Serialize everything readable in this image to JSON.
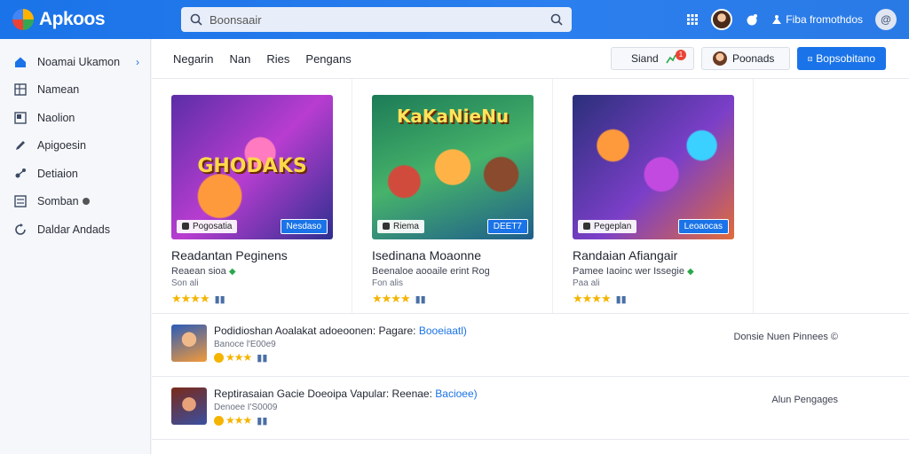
{
  "app": {
    "name": "Apkoos"
  },
  "search": {
    "placeholder": "Boonsaair"
  },
  "topbar": {
    "user_label": "Fiba fromothdos",
    "avatar_letter": "@"
  },
  "sidebar": {
    "items": [
      {
        "label": "Noamai Ukamon",
        "icon": "home-icon"
      },
      {
        "label": "Namean",
        "icon": "grid-icon"
      },
      {
        "label": "Naolion",
        "icon": "window-icon"
      },
      {
        "label": "Apigoesin",
        "icon": "pen-icon"
      },
      {
        "label": "Detiaion",
        "icon": "share-icon"
      },
      {
        "label": "Somban",
        "icon": "list-icon"
      },
      {
        "label": "Daldar Andads",
        "icon": "refresh-icon"
      }
    ]
  },
  "tabs": [
    "Negarin",
    "Nan",
    "Ries",
    "Pengans"
  ],
  "toolbar": {
    "siand_label": "Siand",
    "poonads_label": "Poonads",
    "primary_label": "Bopsobitano",
    "badge": "1"
  },
  "featured": [
    {
      "art_text": "GHODAKS",
      "chip": "Pogosatia",
      "button": "Nesdaso",
      "title": "Readantan Peginens",
      "sub": "Reaean sioa",
      "sub2": "Son ali",
      "stars": "★★★★"
    },
    {
      "art_text": "KaKaNieNu",
      "chip": "Riema",
      "button": "DEET7",
      "title": "Isedinana Moaonne",
      "sub": "Beenaloe aooaile erint Rog",
      "sub2": "Fon alis",
      "stars": "★★★★"
    },
    {
      "art_text": "",
      "chip": "Pegeplan",
      "button": "Leoaocas",
      "title": "Randaian Afiangair",
      "sub": "Pamee Iaoinc wer Issegie",
      "sub2": "Paa ali",
      "stars": "★★★★"
    }
  ],
  "list": [
    {
      "title": "Podidioshan Aoalakat adoeoonen: Pagare:",
      "link": "Booeiaatl)",
      "sub": "Banoce l'E00e9",
      "stars": "★★★",
      "right": "Donsie Nuen Pinnees ©"
    },
    {
      "title": "Reptirasaian Gacie Doeoipa Vapular: Reenae:",
      "link": "Bacioee)",
      "sub": "Denoee I'S0009",
      "stars": "★★★",
      "right": "Alun Pengages"
    }
  ]
}
